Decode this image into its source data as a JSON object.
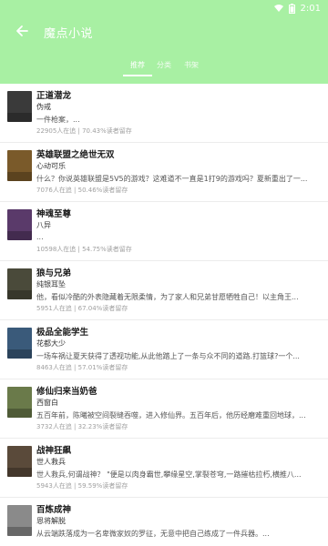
{
  "status": {
    "time": "2:01"
  },
  "header": {
    "title": "魔点小说",
    "tabs": [
      {
        "label": "推荐"
      },
      {
        "label": "分类"
      },
      {
        "label": "书架"
      }
    ]
  },
  "books": [
    {
      "title": "正道潜龙",
      "author": "伪戒",
      "desc": "一件枪案，...",
      "stats": "22905人在追 | 70.43%读者留存",
      "cover_color": "#3a3a3a"
    },
    {
      "title": "英雄联盟之绝世无双",
      "author": "心动可乐",
      "desc": "什么？你说英雄联盟是5V5的游戏？这难道不一直是1打9的游戏吗？夏新重出了一...",
      "stats": "7076人在追 | 50.46%读者留存",
      "cover_color": "#7a5a2a"
    },
    {
      "title": "神魂至尊",
      "author": "八异",
      "desc": "...",
      "stats": "10598人在追 | 54.75%读者留存",
      "cover_color": "#5a3a6a"
    },
    {
      "title": "狼与兄弟",
      "author": "纯银耳坠",
      "desc": "他，看似冷酷的外表隐藏着无限柔情，为了家人和兄弟甘愿牺牲自己！以主角王...",
      "stats": "5951人在追 | 67.04%读者留存",
      "cover_color": "#4a4a3a"
    },
    {
      "title": "极品全能学生",
      "author": "花都大少",
      "desc": "一场车祸让夏天获得了透视功能,从此他踏上了一条与众不同的道路.打篮球?一个...",
      "stats": "8463人在追 | 57.01%读者留存",
      "cover_color": "#3a5a7a"
    },
    {
      "title": "修仙归来当奶爸",
      "author": "西窗白",
      "desc": "五百年前，陈曦被空间裂缝吞噬，进入修仙界。五百年后，他历经磨难重回地球，...",
      "stats": "3732人在追 | 32.23%读者留存",
      "cover_color": "#6a7a4a"
    },
    {
      "title": "战神狂飙",
      "author": "世人救兵",
      "desc": "世人救兵,何谓战神？ \"便是以肉身霸世,攀缘星空,掌裂苍穹,一路摧枯拉朽,横推八...",
      "stats": "5943人在追 | 59.59%读者留存",
      "cover_color": "#5a4a3a"
    },
    {
      "title": "百炼成神",
      "author": "恩将解脱",
      "desc": "从云端跌落成为一名卑微家奴的罗征，无意中把自己练成了一件兵器。...",
      "stats": "",
      "cover_color": "#8a8a8a"
    }
  ]
}
